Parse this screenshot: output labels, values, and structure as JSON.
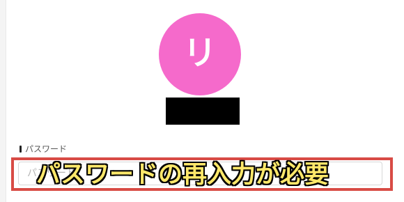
{
  "profile": {
    "avatar_initial": "リ",
    "avatar_color": "#f56acb",
    "name_redacted_color": "#000000"
  },
  "password": {
    "label": "パスワード",
    "placeholder": "パスワード",
    "value": ""
  },
  "annotation": {
    "text": "パスワードの再入力が必要",
    "border_color": "#d84b45",
    "text_color": "#ffe86a",
    "text_outline_color": "#000000"
  }
}
